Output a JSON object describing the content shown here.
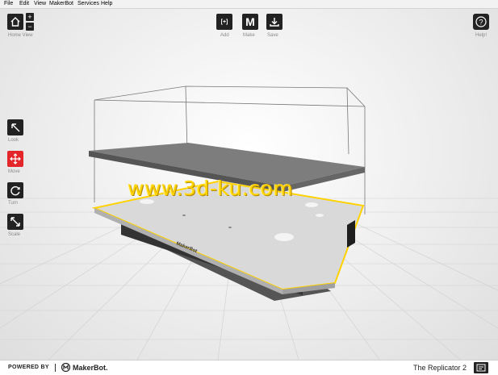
{
  "menu": [
    "File",
    "Edit",
    "View",
    "MakerBot",
    "Services",
    "Help"
  ],
  "toolbar": {
    "home_view": "Home View",
    "add": "Add",
    "make": "Make",
    "save": "Save",
    "help": "Help!",
    "help_glyph": "?",
    "zoom_in": "+",
    "zoom_out": "−",
    "add_glyph": "[+]",
    "make_glyph": "M"
  },
  "tools": {
    "look": "Look",
    "move": "Move",
    "turn": "Turn",
    "scale": "Scale"
  },
  "model": {
    "bed_brand": "MakerBot"
  },
  "watermark": "www.3d-ku.com",
  "footer": {
    "powered_by": "POWERED BY",
    "brand": "MakerBot.",
    "printer": "The Replicator 2"
  },
  "colors": {
    "tool_active": "#e3262a",
    "button": "#222222",
    "selection": "#ffd200"
  }
}
